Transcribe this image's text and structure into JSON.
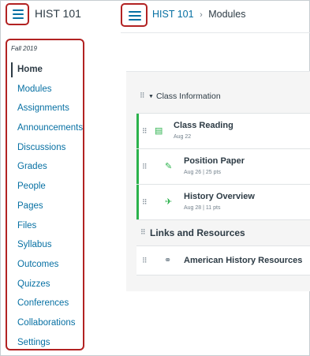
{
  "course": {
    "title": "HIST 101",
    "term": "Fall 2019"
  },
  "breadcrumb": {
    "course": "HIST 101",
    "separator": "›",
    "current": "Modules"
  },
  "nav": {
    "items": [
      {
        "label": "Home",
        "active": true
      },
      {
        "label": "Modules"
      },
      {
        "label": "Assignments"
      },
      {
        "label": "Announcements"
      },
      {
        "label": "Discussions"
      },
      {
        "label": "Grades"
      },
      {
        "label": "People"
      },
      {
        "label": "Pages"
      },
      {
        "label": "Files"
      },
      {
        "label": "Syllabus"
      },
      {
        "label": "Outcomes"
      },
      {
        "label": "Quizzes"
      },
      {
        "label": "Conferences"
      },
      {
        "label": "Collaborations"
      },
      {
        "label": "Settings"
      }
    ]
  },
  "modules": {
    "class_info": {
      "title": "Class Information",
      "items": [
        {
          "name": "Class Reading",
          "meta": "Aug 22",
          "icon": "page-icon"
        },
        {
          "name": "Position Paper",
          "meta": "Aug 26 | 25 pts",
          "icon": "assignment-icon"
        },
        {
          "name": "History Overview",
          "meta": "Aug 28 | 11 pts",
          "icon": "quiz-icon"
        }
      ]
    },
    "links": {
      "title": "Links and Resources",
      "items": [
        {
          "name": "American History Resources",
          "icon": "link-icon"
        }
      ]
    }
  },
  "colors": {
    "accent": "#0770a3",
    "highlight_border": "#b22222",
    "published": "#2bb24c"
  }
}
